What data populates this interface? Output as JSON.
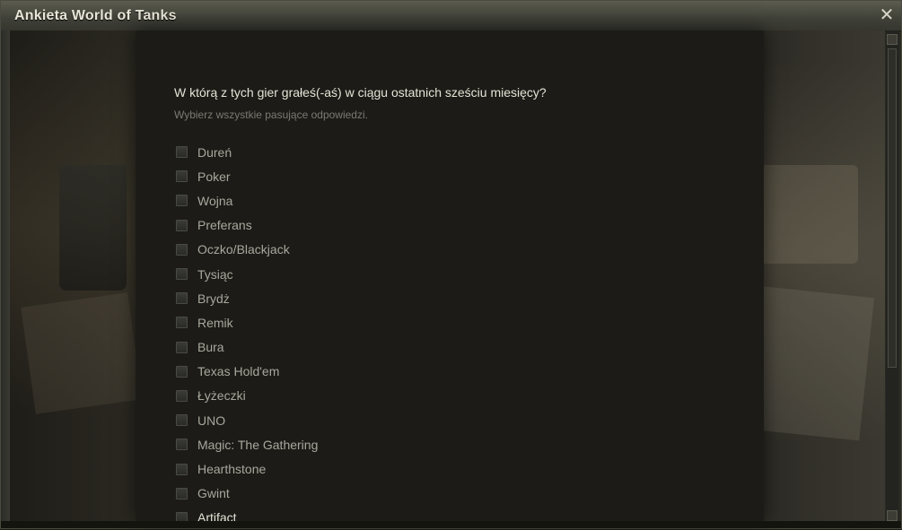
{
  "window": {
    "title": "Ankieta World of Tanks",
    "close_icon": "close-icon"
  },
  "survey": {
    "question": "W którą z tych gier grałeś(-aś) w ciągu ostatnich sześciu miesięcy?",
    "hint": "Wybierz wszystkie pasujące odpowiedzi.",
    "options": [
      "Dureń",
      "Poker",
      "Wojna",
      "Preferans",
      "Oczko/Blackjack",
      "Tysiąc",
      "Brydż",
      "Remik",
      "Bura",
      "Texas Hold'em",
      "Łyżeczki",
      "UNO",
      "Magic: The Gathering",
      "Hearthstone",
      "Gwint",
      "Artifact"
    ]
  },
  "colors": {
    "title_text": "#e8e6d8",
    "question_text": "#e6e3d6",
    "hint_text": "#7c7a70",
    "option_text": "#a9a79c",
    "panel_bg": "#1c1b17"
  }
}
